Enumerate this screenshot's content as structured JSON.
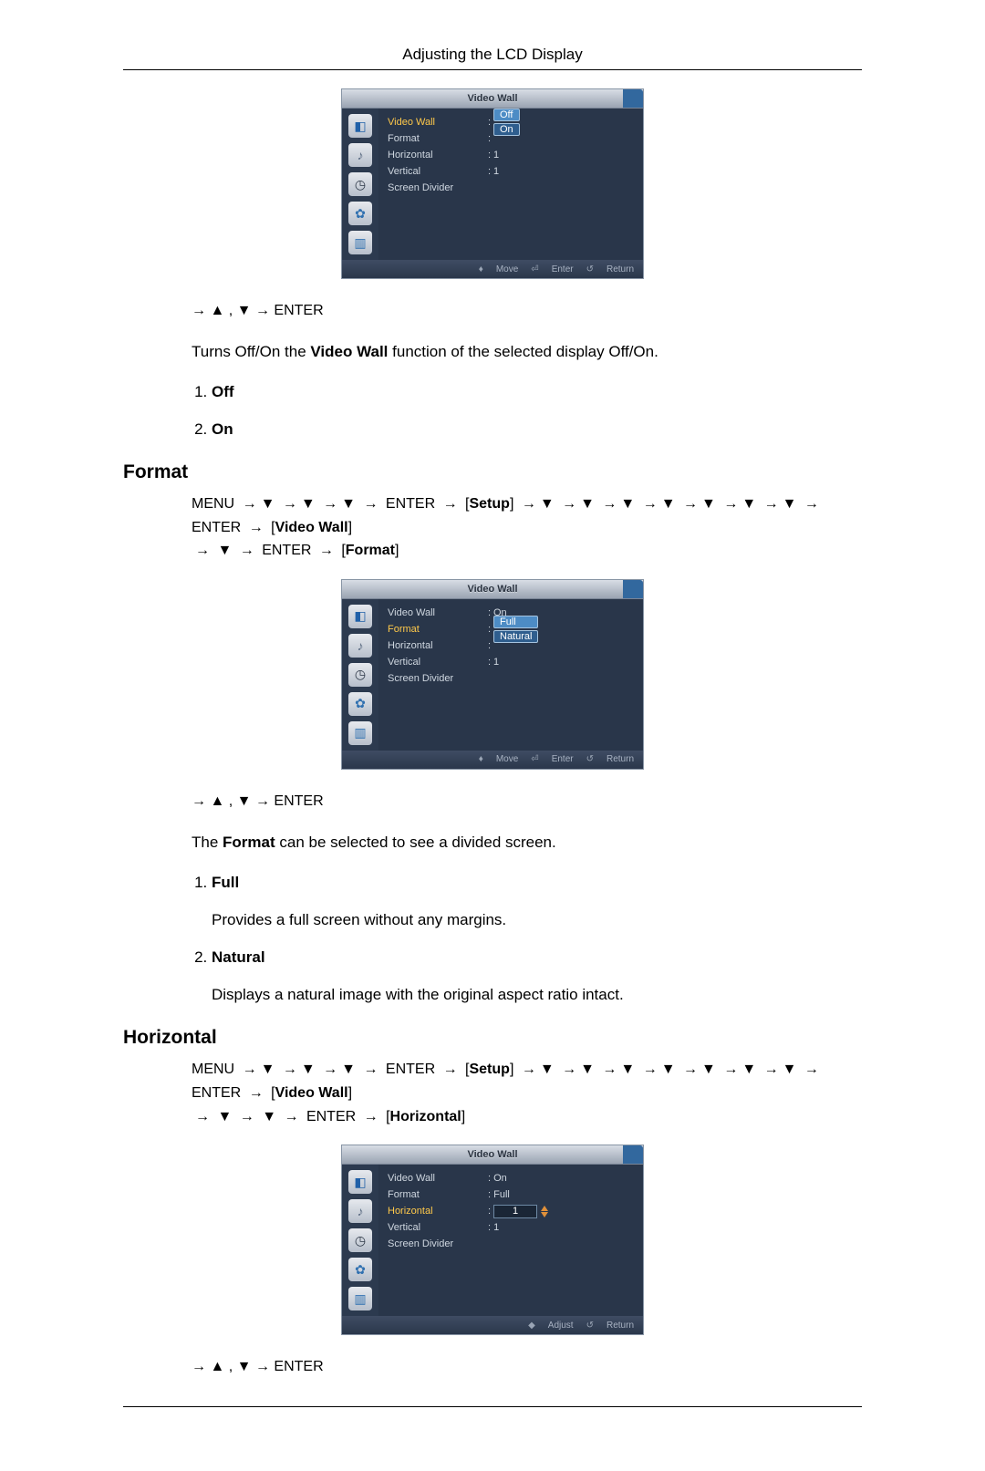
{
  "header": {
    "title": "Adjusting the LCD Display"
  },
  "osd_videowall_onoff": {
    "title": "Video Wall",
    "rows": {
      "video_wall_label": "Video Wall",
      "format_label": "Format",
      "horizontal_label": "Horizontal",
      "vertical_label": "Vertical",
      "screen_divider_label": "Screen Divider",
      "opt_off": "Off",
      "opt_on": "On",
      "val_h": "1",
      "val_v": "1"
    },
    "footer": {
      "move": "Move",
      "enter": "Enter",
      "return": "Return"
    }
  },
  "seq1": {
    "a1": "→",
    "up": "▲",
    "comma": " , ",
    "down": "▼",
    "a2": "→",
    "enter": "ENTER"
  },
  "videowall_intro_pre": "Turns Off/On the ",
  "videowall_intro_strong": "Video Wall",
  "videowall_intro_post": " function of the selected display Off/On.",
  "videowall_options": {
    "off": "Off",
    "on": "On"
  },
  "section_format": {
    "heading": "Format"
  },
  "nav_format": {
    "menu": "MENU",
    "arrow": "→",
    "down": "▼",
    "enter": "ENTER",
    "setup": "Setup",
    "videowall": "Video Wall",
    "format": "Format"
  },
  "osd_format": {
    "title": "Video Wall",
    "rows": {
      "video_wall_label": "Video Wall",
      "format_label": "Format",
      "horizontal_label": "Horizontal",
      "vertical_label": "Vertical",
      "screen_divider_label": "Screen Divider",
      "vw_value": "On",
      "opt_full": "Full",
      "opt_natural": "Natural",
      "val_v": "1"
    },
    "footer": {
      "move": "Move",
      "enter": "Enter",
      "return": "Return"
    }
  },
  "seq2": {
    "a1": "→",
    "up": "▲",
    "comma": " , ",
    "down": "▼",
    "a2": "→",
    "enter": "ENTER"
  },
  "format_text_pre": "The ",
  "format_text_strong": "Format",
  "format_text_post": " can be selected to see a divided screen.",
  "format_options": {
    "full_label": "Full",
    "full_desc": "Provides a full screen without any margins.",
    "natural_label": "Natural",
    "natural_desc": "Displays a natural image with the original aspect ratio intact."
  },
  "section_horizontal": {
    "heading": "Horizontal"
  },
  "nav_horizontal": {
    "menu": "MENU",
    "arrow": "→",
    "down": "▼",
    "enter": "ENTER",
    "setup": "Setup",
    "videowall": "Video Wall",
    "horizontal": "Horizontal"
  },
  "osd_horizontal": {
    "title": "Video Wall",
    "rows": {
      "video_wall_label": "Video Wall",
      "format_label": "Format",
      "horizontal_label": "Horizontal",
      "vertical_label": "Vertical",
      "screen_divider_label": "Screen Divider",
      "vw_value": "On",
      "fmt_value": "Full",
      "h_value": "1",
      "v_value": "1"
    },
    "footer": {
      "adjust": "Adjust",
      "return": "Return"
    }
  },
  "seq3": {
    "a1": "→",
    "up": "▲",
    "comma": " , ",
    "down": "▼",
    "a2": "→",
    "enter": "ENTER"
  },
  "glyphs": {
    "colon": ":",
    "move_diamond": "♦",
    "enter_box": "⏎",
    "return_arc": "↺",
    "adjust_lr": "◆"
  }
}
